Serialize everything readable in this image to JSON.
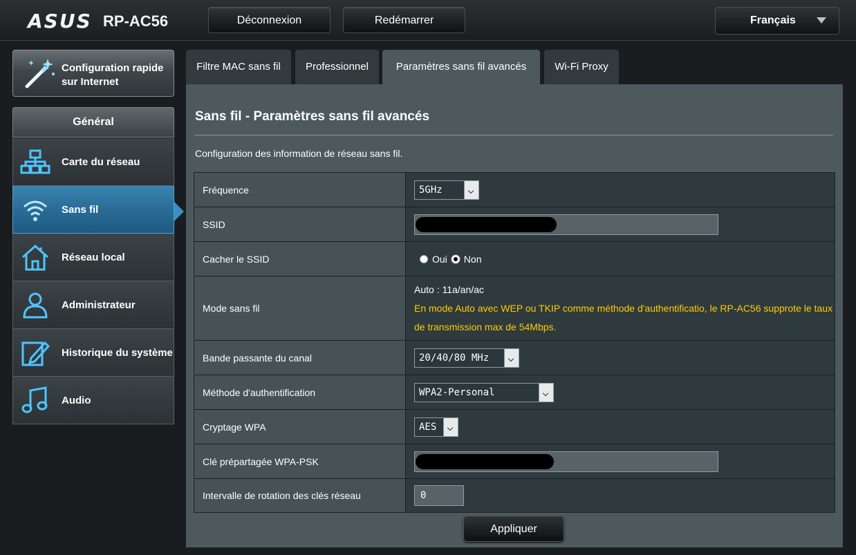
{
  "header": {
    "brand": "ASUS",
    "model": "RP-AC56",
    "logout_label": "Déconnexion",
    "reboot_label": "Redémarrer",
    "language": "Français"
  },
  "sidebar": {
    "quick_setup_label": "Configuration rapide sur Internet",
    "section_label": "Général",
    "items": [
      {
        "label": "Carte du réseau",
        "icon": "network-map-icon"
      },
      {
        "label": "Sans fil",
        "icon": "wifi-icon",
        "active": true
      },
      {
        "label": "Réseau local",
        "icon": "house-icon"
      },
      {
        "label": "Administrateur",
        "icon": "user-icon"
      },
      {
        "label": "Historique du système",
        "icon": "log-edit-icon"
      },
      {
        "label": "Audio",
        "icon": "music-note-icon"
      }
    ]
  },
  "tabs": [
    {
      "label": "Filtre MAC sans fil"
    },
    {
      "label": "Professionnel"
    },
    {
      "label": "Paramètres sans fil avancés",
      "active": true
    },
    {
      "label": "Wi-Fi Proxy"
    }
  ],
  "main": {
    "title": "Sans fil - Paramètres sans fil avancés",
    "description": "Configuration des information de réseau sans fil.",
    "fields": {
      "frequency": {
        "label": "Fréquence",
        "value": "5GHz"
      },
      "ssid": {
        "label": "SSID",
        "value": ""
      },
      "hide_ssid": {
        "label": "Cacher le SSID",
        "option_yes": "Oui",
        "option_no": "Non",
        "selected": "Non"
      },
      "wireless_mode": {
        "label": "Mode sans fil",
        "value": "Auto : 11a/an/ac",
        "note": "En mode Auto avec WEP ou TKIP comme méthode d'authentificatio, le RP-AC56 supprote le taux de transmission max de 54Mbps."
      },
      "bandwidth": {
        "label": "Bande passante du canal",
        "value": "20/40/80 MHz"
      },
      "auth_method": {
        "label": "Méthode d'authentification",
        "value": "WPA2-Personal"
      },
      "wpa_encryption": {
        "label": "Cryptage WPA",
        "value": "AES"
      },
      "wpa_psk": {
        "label": "Clé prépartagée WPA-PSK",
        "value": ""
      },
      "key_rotation": {
        "label": "Intervalle de rotation des clés réseau",
        "value": "0"
      }
    },
    "apply_label": "Appliquer"
  },
  "colors": {
    "accent": "#2a6c96",
    "warning_text": "#ffcc00",
    "panel": "#4d595d"
  }
}
